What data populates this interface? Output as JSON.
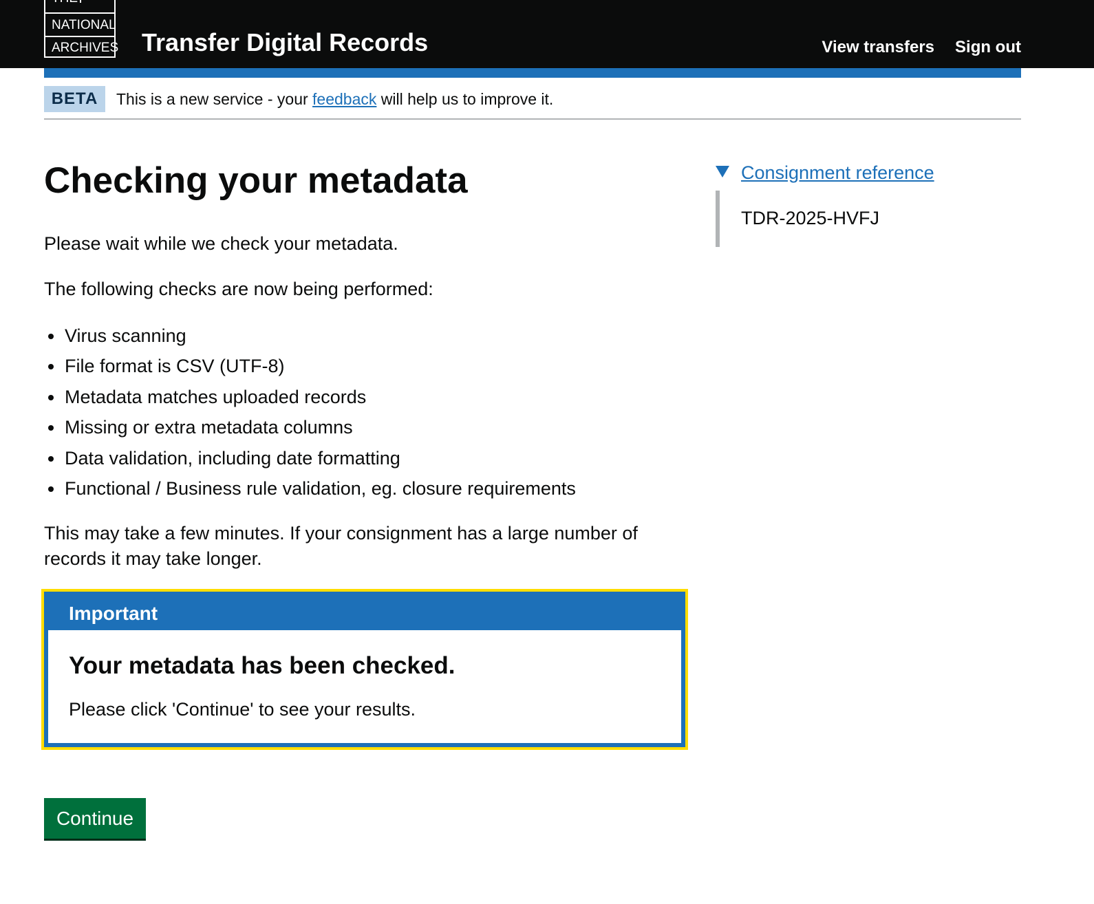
{
  "header": {
    "logo_lines": [
      "THE",
      "NATIONAL",
      "ARCHIVES"
    ],
    "service_name": "Transfer Digital Records",
    "nav": {
      "view_transfers": "View transfers",
      "sign_out": "Sign out"
    },
    "colors": {
      "background": "#0b0c0c",
      "accent_bar": "#1d70b8"
    }
  },
  "phase_banner": {
    "tag": "BETA",
    "text_before": "This is a new service - your",
    "link": "feedback",
    "text_after": "will help us to improve it."
  },
  "main": {
    "title": "Checking your metadata",
    "intro": "Please wait while we check your metadata.",
    "checks_intro": "The following checks are now being performed:",
    "checks": [
      "Virus scanning",
      "File format is CSV (UTF-8)",
      "Metadata matches uploaded records",
      "Missing or extra metadata columns",
      "Data validation, including date formatting",
      "Functional / Business rule validation, eg. closure requirements"
    ],
    "duration_note": "This may take a few minutes. If your consignment has a large number of records it may take longer."
  },
  "notification": {
    "header": "Important",
    "heading": "Your metadata has been checked.",
    "body": "Please click 'Continue' to see your results.",
    "colors": {
      "border": "#1d70b8",
      "focus": "#ffdd00"
    }
  },
  "continue_button": {
    "label": "Continue",
    "color": "#00703c"
  },
  "sidebar": {
    "details_summary": "Consignment reference",
    "details_value": "TDR-2025-HVFJ",
    "icon": "triangle-down-icon"
  }
}
